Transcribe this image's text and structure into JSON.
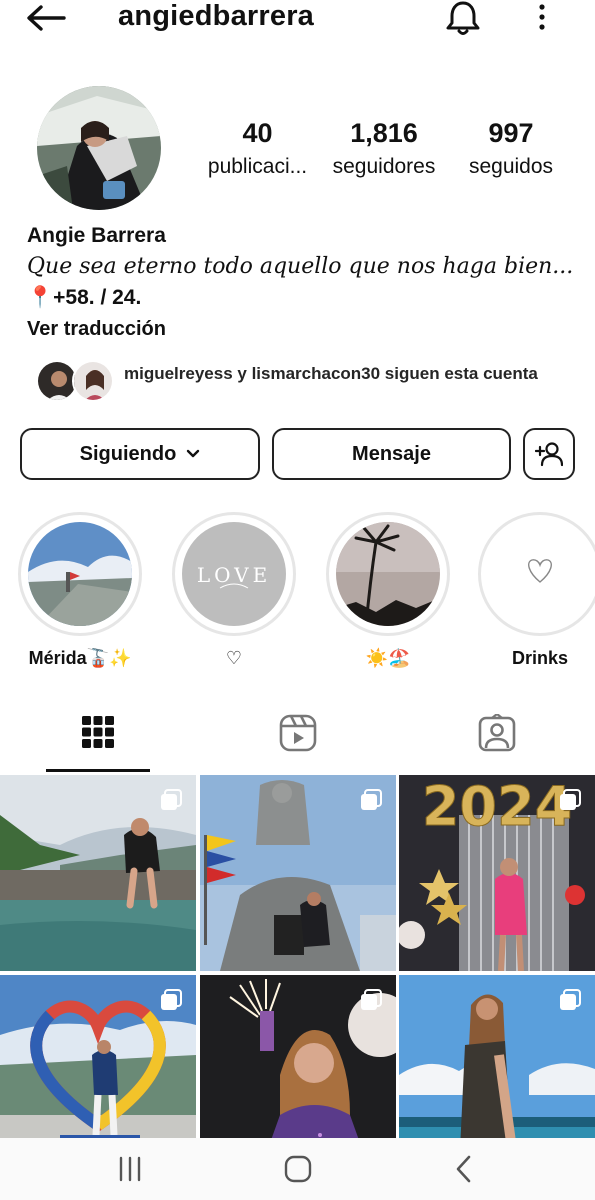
{
  "header": {
    "username": "angiedbarrera"
  },
  "stats": {
    "posts_value": "40",
    "posts_label": "publicaci...",
    "followers_value": "1,816",
    "followers_label": "seguidores",
    "following_value": "997",
    "following_label": "seguidos"
  },
  "bio": {
    "name": "Angie Barrera",
    "text": "Que sea eterno todo aquello que nos haga bien...",
    "location": "📍+58. / 24.",
    "translate_link": "Ver traducción"
  },
  "mutual": {
    "text": "miguelreyess y lismarchacon30 siguen esta cuenta"
  },
  "actions": {
    "following_label": "Siguiendo",
    "message_label": "Mensaje"
  },
  "highlights": [
    {
      "label": "Mérida🚡✨"
    },
    {
      "label": "♡",
      "cover_text": "LOVE"
    },
    {
      "label": "☀️🏖️"
    },
    {
      "label": "Drinks"
    }
  ],
  "tabs": [
    {
      "icon": "grid-icon",
      "selected": true
    },
    {
      "icon": "reels-icon",
      "selected": false
    },
    {
      "icon": "tagged-icon",
      "selected": false
    }
  ],
  "posts": [
    {
      "index": 1,
      "multi": true
    },
    {
      "index": 2,
      "multi": true
    },
    {
      "index": 3,
      "multi": true,
      "overlay_text": "2024"
    },
    {
      "index": 4,
      "multi": true
    },
    {
      "index": 5,
      "multi": true
    },
    {
      "index": 6,
      "multi": true
    }
  ],
  "colors": {
    "text": "#111111",
    "border": "#222222",
    "ring": "#e6e6e6"
  }
}
